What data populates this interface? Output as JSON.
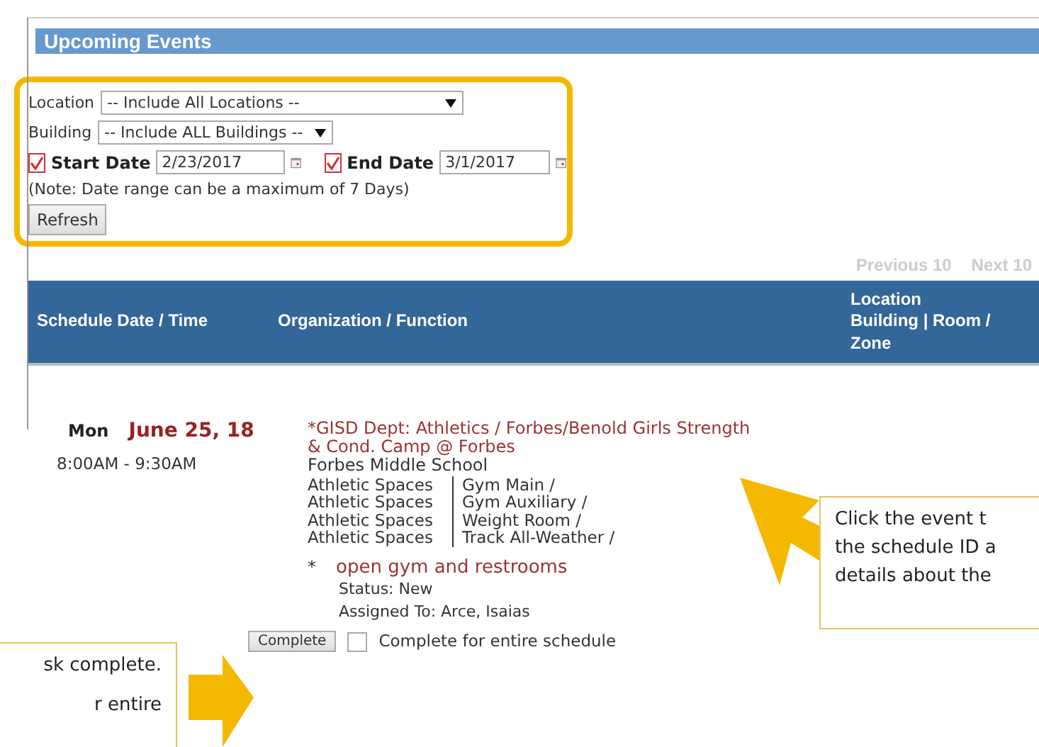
{
  "panel": {
    "title": "Upcoming Events"
  },
  "filters": {
    "location": {
      "label": "Location",
      "value": "-- Include All Locations --"
    },
    "building": {
      "label": "Building",
      "value": "-- Include ALL Buildings --"
    },
    "start_date": {
      "label": "Start Date",
      "checked": true,
      "value": "2/23/2017"
    },
    "end_date": {
      "label": "End Date",
      "checked": true,
      "value": "3/1/2017"
    },
    "note": "(Note: Date range can be a maximum of 7 Days)",
    "refresh": "Refresh"
  },
  "pager": {
    "previous": "Previous 10",
    "next": "Next 10"
  },
  "table": {
    "columns": [
      "Schedule Date / Time",
      "Organization / Function",
      "Location\nBuilding | Room /\nZone"
    ],
    "rows": [
      {
        "day": "Mon",
        "date": "June 25, 18",
        "time": "8:00AM - 9:30AM",
        "title": "*GISD Dept: Athletics / Forbes/Benold Girls Strength & Cond. Camp @ Forbes",
        "building": "Forbes Middle School",
        "spaces": [
          {
            "area": "Athletic Spaces",
            "room": "Gym Main /"
          },
          {
            "area": "Athletic Spaces",
            "room": "Gym Auxiliary /"
          },
          {
            "area": "Athletic Spaces",
            "room": "Weight Room /"
          },
          {
            "area": "Athletic Spaces",
            "room": "Track All-Weather /"
          }
        ],
        "note_mark": "*",
        "note": "open gym and restrooms",
        "status": "Status: New",
        "assigned": "Assigned To: Arce, Isaias",
        "complete_button": "Complete",
        "complete_all": {
          "label": "Complete for entire schedule",
          "checked": false
        }
      }
    ]
  },
  "callouts": [
    {
      "kind": "right",
      "lines": [
        "Click the event t",
        "the schedule ID a",
        "details about the"
      ]
    },
    {
      "kind": "left",
      "lines": [
        "sk complete.",
        "r entire"
      ]
    }
  ]
}
